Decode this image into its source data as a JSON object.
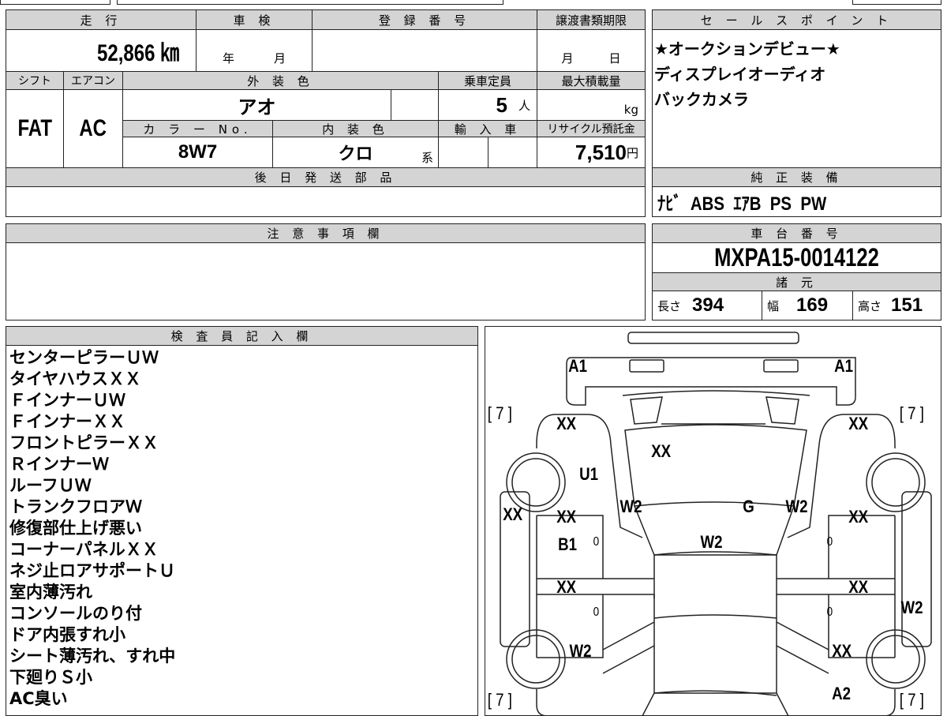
{
  "labels": {
    "mileage": "走 行",
    "inspection": "車 検",
    "registration": "登 録 番 号",
    "transfer_deadline": "譲渡書類期限",
    "shift": "シフト",
    "aircon": "エアコン",
    "exterior_color": "外 装 色",
    "capacity": "乗車定員",
    "max_load": "最大積載量",
    "color_no": "カ ラ ー No.",
    "interior_color": "内 装 色",
    "import": "輸 入 車",
    "recycle_fee": "リサイクル預託金",
    "later_parts": "後 日 発 送 部 品",
    "sales_point": "セ ー ル ス ポ イ ン ト",
    "std_equipment": "純 正 装 備",
    "notes": "注 意 事 項 欄",
    "chassis_no": "車 台 番 号",
    "specs": "諸 元",
    "inspector": "検 査 員 記 入 欄",
    "year": "年",
    "month": "月",
    "day": "日",
    "person": "人",
    "kg": "kg",
    "yen": "円",
    "kei": "系",
    "length": "長さ",
    "width": "幅",
    "height": "高さ"
  },
  "values": {
    "mileage": "52,866 ㎞",
    "shift": "FAT",
    "aircon": "AC",
    "exterior_color": "アオ",
    "capacity": "5",
    "color_no": "8W7",
    "interior_color": "クロ",
    "recycle_fee": "7,510",
    "std_equipment": "ﾅﾋﾞ  ABS  ｴｱB  PS  PW",
    "chassis_no": "MXPA15-0014122",
    "length": "394",
    "width": "169",
    "height": "151"
  },
  "sales_points": [
    "★オークションデビュー★",
    "ディスプレイオーディオ",
    "バックカメラ"
  ],
  "inspector_notes": [
    "センターピラーＵＷ",
    "タイヤハウスＸＸ",
    "ＦインナーＵＷ",
    "ＦインナーＸＸ",
    "フロントピラーＸＸ",
    "ＲインナーＷ",
    "ルーフＵＷ",
    "トランクフロアＷ",
    "修復部仕上げ悪い",
    "コーナーパネルＸＸ",
    "ネジ止ロアサポートＵ",
    "室内薄汚れ",
    "コンソールのり付",
    "ドア内張すれ小",
    "シート薄汚れ、すれ中",
    "下廻りＳ小",
    "AC臭い"
  ],
  "diagram": {
    "a1_left": "A1",
    "a1_right": "A1",
    "tire_fl": "[ 7 ]",
    "tire_fr": "[ 7 ]",
    "tire_rl": "[ 7 ]",
    "tire_rr": "[ 7 ]",
    "fender_fl": "XX",
    "fender_fr": "XX",
    "hood": "XX",
    "pillar": "U1",
    "w2_left": "W2",
    "g": "G",
    "w2_right": "W2",
    "roof": "W2",
    "sill_left": "XX",
    "door_fl": "XX",
    "b1": "B1",
    "door_fr": "XX",
    "door_rl": "XX",
    "door_rr": "XX",
    "sill_right": "W2",
    "qtr_left": "W2",
    "qtr_right": "XX",
    "a2": "A2",
    "zero1": "0",
    "zero2": "0",
    "zero3": "0",
    "zero4": "0"
  }
}
